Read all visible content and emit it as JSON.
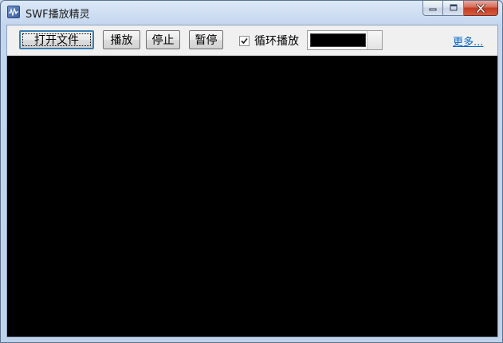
{
  "window": {
    "title": "SWF播放精灵",
    "icon": "swf-player-app-icon"
  },
  "caption_buttons": {
    "minimize_icon": "minimize-icon",
    "maximize_icon": "maximize-icon",
    "close_icon": "close-icon"
  },
  "toolbar": {
    "open_file_label": "打开文件",
    "play_label": "播放",
    "stop_label": "停止",
    "pause_label": "暂停",
    "loop_label": "循环播放",
    "loop_checked": true,
    "background_color": "#000000",
    "more_link": "更多..."
  },
  "stage": {
    "background_color": "#000000"
  }
}
